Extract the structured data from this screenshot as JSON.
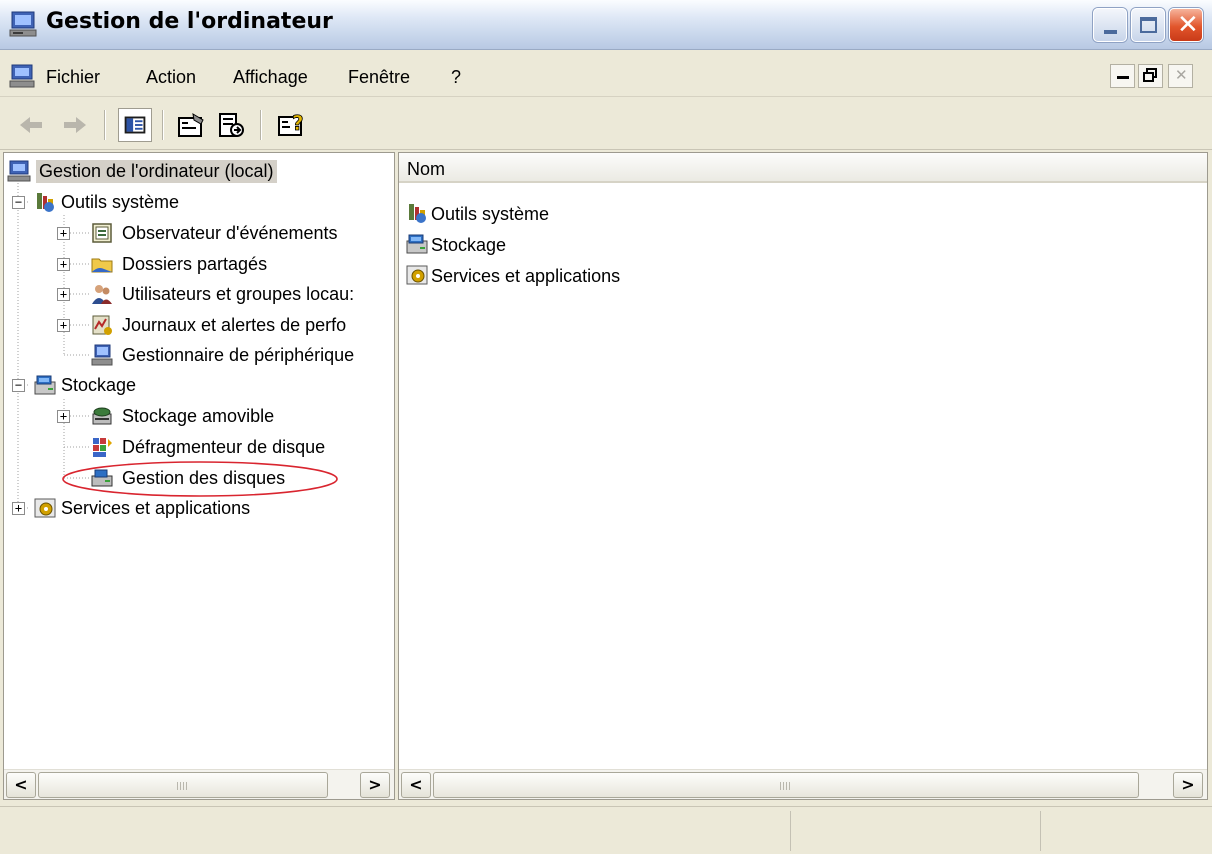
{
  "window": {
    "title": "Gestion de l'ordinateur",
    "icon": "computer-management-icon",
    "accent": "#c9d7ec",
    "close_color": "#e2562c"
  },
  "menubar": {
    "items": [
      {
        "label": "Fichier"
      },
      {
        "label": "Action"
      },
      {
        "label": "Affichage"
      },
      {
        "label": "Fenêtre"
      },
      {
        "label": "?"
      }
    ]
  },
  "toolbar": {
    "buttons": [
      {
        "icon": "back-arrow-icon"
      },
      {
        "icon": "forward-arrow-icon"
      },
      {
        "icon": "show-hide-tree-icon"
      },
      {
        "icon": "properties-icon"
      },
      {
        "icon": "export-list-icon"
      },
      {
        "icon": "help-icon"
      }
    ]
  },
  "tree": {
    "root": "Gestion de l'ordinateur (local)",
    "outils": "Outils système",
    "observateur": "Observateur d'événements",
    "dossiers": "Dossiers partagés",
    "utilisateurs": "Utilisateurs et groupes locau:",
    "journaux": "Journaux et alertes de perfo",
    "gestionnaire": "Gestionnaire de périphérique",
    "stockage": "Stockage",
    "amovible": "Stockage amovible",
    "defrag": "Défragmenteur de disque",
    "disques": "Gestion des disques",
    "services": "Services et applications",
    "highlight_color": "#d9252f"
  },
  "list": {
    "column_header": "Nom",
    "items": [
      {
        "label": "Outils système"
      },
      {
        "label": "Stockage"
      },
      {
        "label": "Services et applications"
      }
    ]
  },
  "scroll": {
    "left_arrow": "<",
    "right_arrow": ">"
  }
}
